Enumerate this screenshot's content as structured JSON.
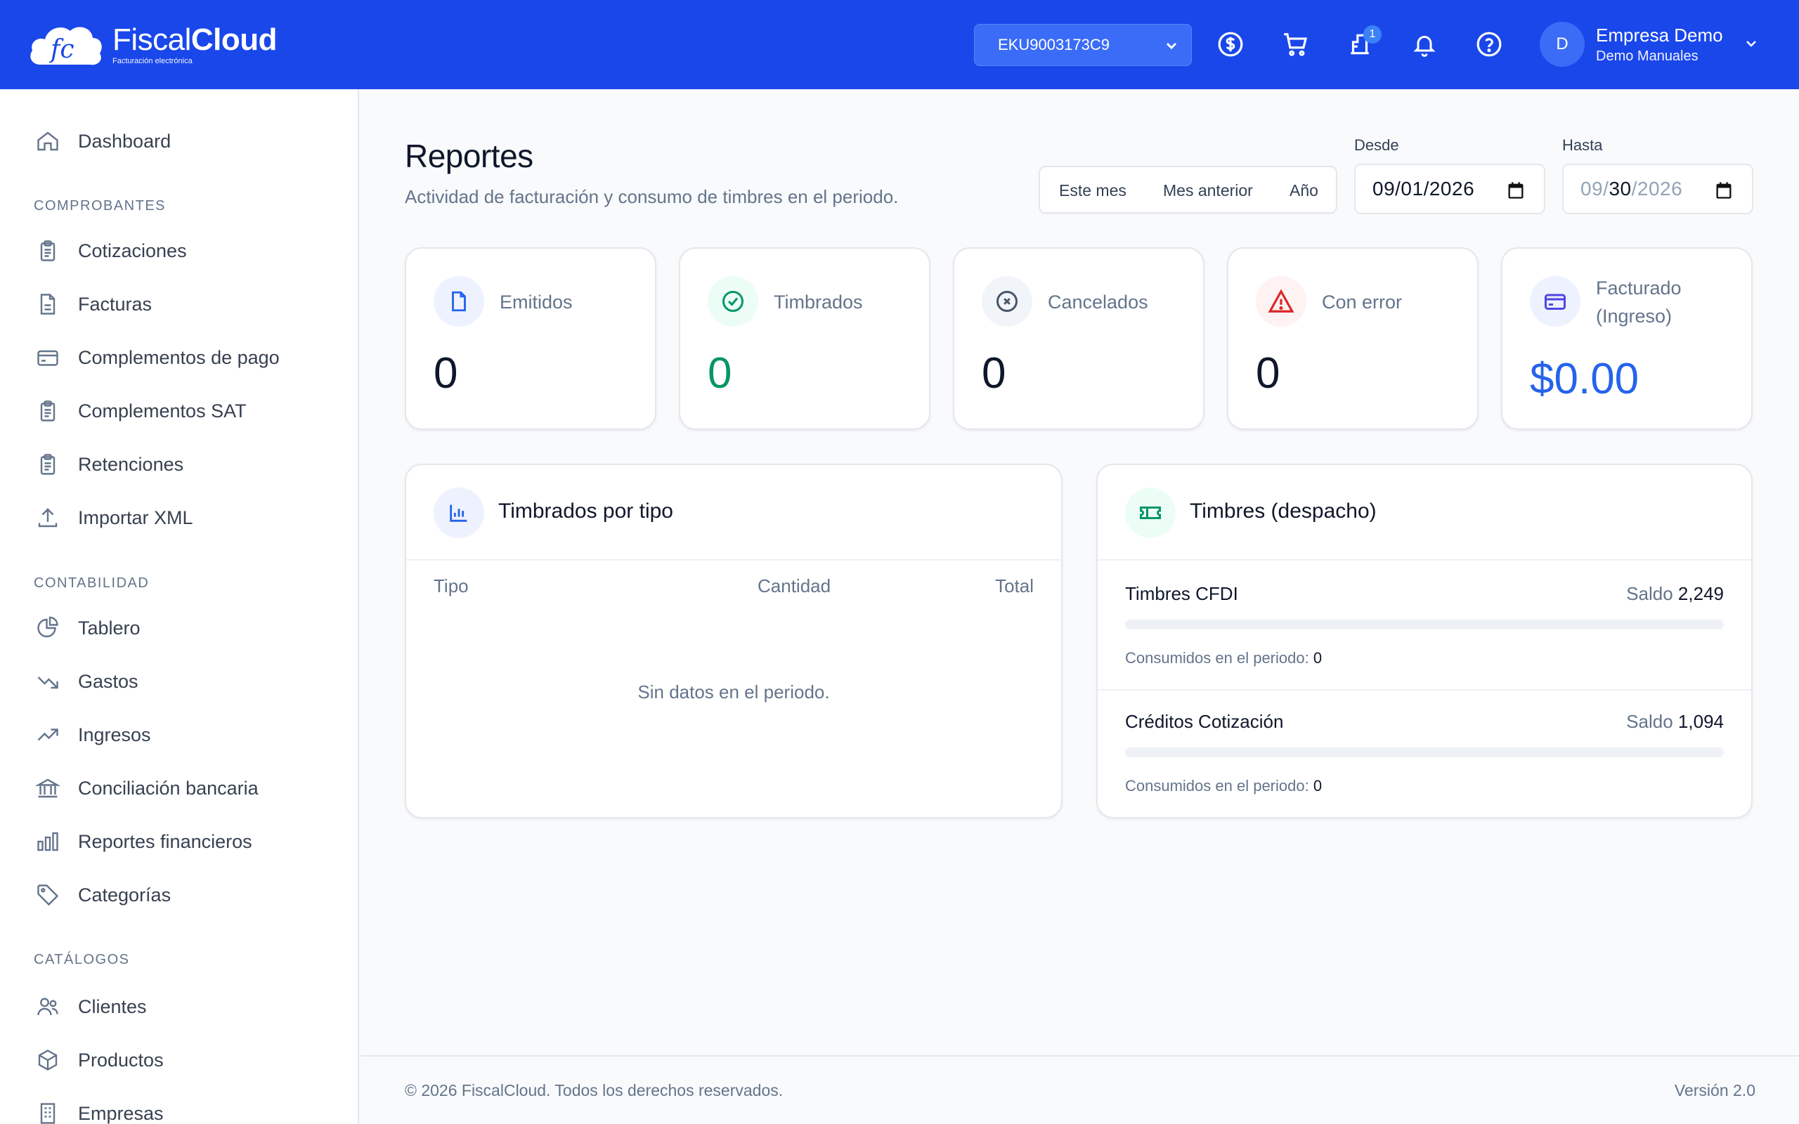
{
  "brand": {
    "name_light": "Fiscal",
    "name_bold": "Cloud",
    "tagline": "Facturación electrónica",
    "logo_initials": "fc"
  },
  "header": {
    "rfc_selected": "EKU9003173C9",
    "notifications_badge": "1",
    "user": {
      "avatar_letter": "D",
      "name": "Empresa Demo",
      "subtitle": "Demo Manuales"
    }
  },
  "sidebar": {
    "dashboard": "Dashboard",
    "sections": {
      "comprobantes": "COMPROBANTES",
      "contabilidad": "CONTABILIDAD",
      "catalogos": "CATÁLOGOS"
    },
    "comprobantes": [
      "Cotizaciones",
      "Facturas",
      "Complementos de pago",
      "Complementos SAT",
      "Retenciones",
      "Importar XML"
    ],
    "contabilidad": [
      "Tablero",
      "Gastos",
      "Ingresos",
      "Conciliación bancaria",
      "Reportes financieros",
      "Categorías"
    ],
    "catalogos": [
      "Clientes",
      "Productos",
      "Empresas"
    ]
  },
  "page": {
    "title": "Reportes",
    "subtitle": "Actividad de facturación y consumo de timbres en el periodo.",
    "range_buttons": [
      "Este mes",
      "Mes anterior",
      "Año"
    ],
    "desde_label": "Desde",
    "desde_value": "09/01/2026",
    "hasta_label": "Hasta",
    "hasta_mm": "09",
    "hasta_sep1": "/",
    "hasta_dd": "30",
    "hasta_sep2": "/",
    "hasta_yyyy": "2026"
  },
  "stats": [
    {
      "label": "Emitidos",
      "value": "0"
    },
    {
      "label": "Timbrados",
      "value": "0"
    },
    {
      "label": "Cancelados",
      "value": "0"
    },
    {
      "label": "Con error",
      "value": "0"
    },
    {
      "label_line1": "Facturado",
      "label_line2": "(Ingreso)",
      "value": "$0.00"
    }
  ],
  "timbrados_por_tipo": {
    "title": "Timbrados por tipo",
    "columns": [
      "Tipo",
      "Cantidad",
      "Total"
    ],
    "empty_message": "Sin datos en el periodo."
  },
  "timbres": {
    "title": "Timbres (despacho)",
    "saldo_label": "Saldo",
    "consumidos_label": "Consumidos en el periodo:",
    "items": [
      {
        "name": "Timbres CFDI",
        "saldo": "2,249",
        "consumidos": "0",
        "consumed_fraction": 0
      },
      {
        "name": "Créditos Cotización",
        "saldo": "1,094",
        "consumidos": "0",
        "consumed_fraction": 0
      }
    ]
  },
  "footer": {
    "copyright": "© 2026 FiscalCloud. Todos los derechos reservados.",
    "version": "Versión 2.0"
  },
  "colors": {
    "header_bg": "#1a47ea",
    "accent_blue": "#2563eb",
    "success_green": "#059669",
    "error_red": "#dc2626"
  }
}
